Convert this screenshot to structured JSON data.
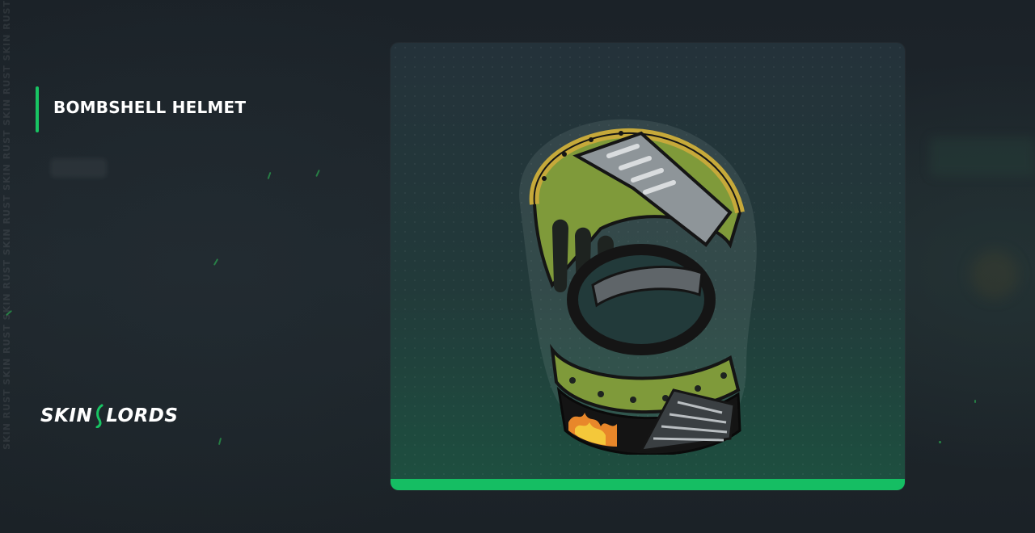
{
  "item": {
    "name": "BOMBSHELL HELMET",
    "image_subject": "bombshell-helmet-icon"
  },
  "brand": {
    "logo_left": "SKIN",
    "logo_right": "LORDS",
    "watermark": "SKIN RUST SKIN RUST SKIN RUST SKIN RUST SKIN RUST SKIN RUST SKIN RUST"
  },
  "colors": {
    "accent": "#18c463",
    "background": "#1c2329",
    "card_top": "#24323a",
    "card_bottom": "#1d5040"
  }
}
